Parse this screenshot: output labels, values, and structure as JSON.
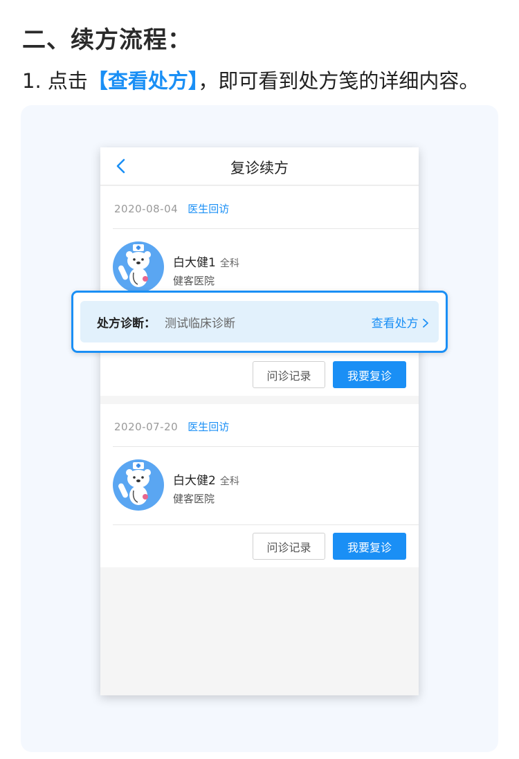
{
  "heading": "二、续方流程：",
  "step": {
    "prefix": "1. 点击",
    "highlight": "【查看处方】",
    "suffix": "，即可看到处方笺的详细内容。"
  },
  "phone": {
    "nav_title": "复诊续方",
    "cards": [
      {
        "date": "2020-08-04",
        "type": "医生回访",
        "doctor": "白大健1",
        "dept": "全科",
        "hospital": "健客医院",
        "btn_record": "问诊记录",
        "btn_revisit": "我要复诊"
      },
      {
        "date": "2020-07-20",
        "type": "医生回访",
        "doctor": "白大健2",
        "dept": "全科",
        "hospital": "健客医院",
        "btn_record": "问诊记录",
        "btn_revisit": "我要复诊"
      }
    ]
  },
  "prescription": {
    "label": "处方诊断：",
    "value": "测试临床诊断",
    "link": "查看处方"
  },
  "colors": {
    "accent": "#1a8ff5",
    "panel_bg": "#f4f8fe",
    "highlight_bg": "#e2f1fc"
  },
  "icons": [
    "back-chevron-icon",
    "doctor-bear-avatar-icon",
    "chevron-right-icon"
  ]
}
